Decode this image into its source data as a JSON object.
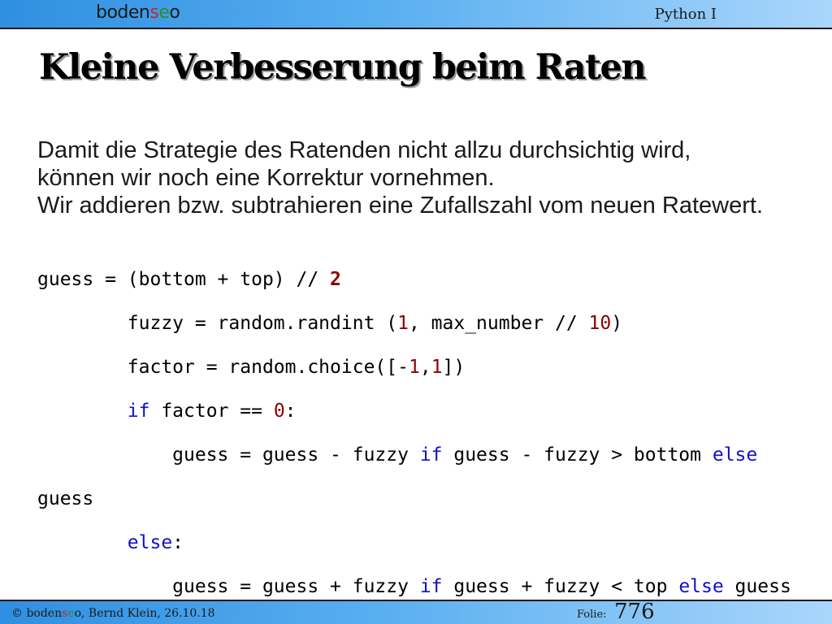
{
  "header": {
    "logo": {
      "part1": "boden",
      "s": "s",
      "e": "e",
      "o": "o"
    },
    "course": "Python I"
  },
  "slide": {
    "title": "Kleine Verbesserung beim Raten",
    "body": [
      "Damit die Strategie des Ratenden nicht allzu durchsichtig wird,",
      "können wir noch eine Korrektur vornehmen.",
      "Wir addieren bzw. subtrahieren eine Zufallszahl vom neuen Ratewert."
    ],
    "code": {
      "l1": {
        "a": "guess = (bottom + top) // ",
        "n": "2"
      },
      "l2": {
        "a": "        fuzzy = random.randint (",
        "n1": "1",
        "b": ", max_number // ",
        "n2": "10",
        "c": ")"
      },
      "l3": {
        "a": "        factor = random.choice([-",
        "n1": "1",
        "b": ",",
        "n2": "1",
        "c": "])"
      },
      "l4": {
        "kw": "if",
        "a": " factor == ",
        "n": "0",
        "b": ":"
      },
      "l5": {
        "a": "            guess = guess - fuzzy ",
        "kw1": "if",
        "b": " guess - fuzzy > bottom ",
        "kw2": "else"
      },
      "l6": {
        "a": "guess"
      },
      "l7": {
        "kw": "else",
        "a": ":"
      },
      "l8": {
        "a": "            guess = guess + fuzzy ",
        "kw1": "if",
        "b": " guess + fuzzy < top ",
        "kw2": "else",
        "c": " guess"
      }
    }
  },
  "footer": {
    "copyright": "© boden",
    "copy_s": "s",
    "copy_e": "e",
    "copy_rest": "o, Bernd Klein, 26.10.18",
    "folie_label": "Folie:",
    "folie_number": "776"
  },
  "colors": {
    "bar_gradient_start": "#2f8fe0",
    "bar_gradient_end": "#a9d6fb",
    "keyword": "#1010c8",
    "number": "#8b0000"
  }
}
